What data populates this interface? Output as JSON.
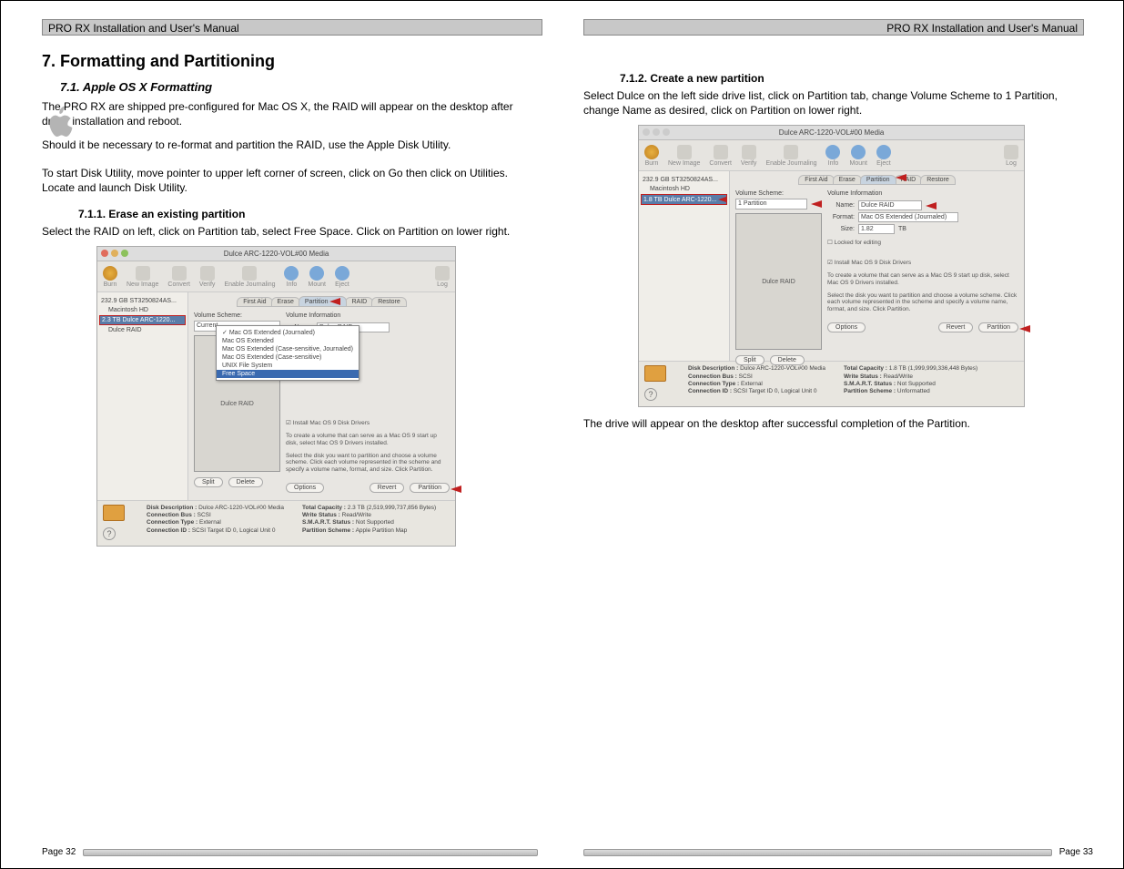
{
  "header": "PRO RX Installation and User's Manual",
  "left": {
    "h1": "7. Formatting and Partitioning",
    "h2": "7.1.        Apple OS X Formatting",
    "p1": "The PRO RX are shipped pre-configured for Mac OS X, the RAID will appear on the desktop after driver installation and reboot.",
    "p2": "Should it be necessary to re-format and partition the RAID, use the Apple Disk Utility.",
    "p3": "To start Disk Utility, move pointer to upper left corner of screen, click on Go then click on Utilities.  Locate and launch Disk Utility.",
    "h3": "7.1.1. Erase an existing partition",
    "p4": "Select the RAID on left, click on Partition tab, select Free Space.  Click on Partition on lower right.",
    "pagenum": "Page 32"
  },
  "right": {
    "h3": "7.1.2. Create a new partition",
    "p1": "Select Dulce on the left side drive list, click on Partition tab, change Volume Scheme to 1 Partition, change Name as desired, click on Partition on lower right.",
    "p2": "The drive will appear on the desktop after successful completion of the Partition.",
    "pagenum": "Page 33"
  },
  "screenshot_common": {
    "toolbar": [
      "Burn",
      "New Image",
      "Convert",
      "Verify",
      "Enable Journaling",
      "Info",
      "Mount",
      "Eject"
    ],
    "log": "Log",
    "tabs": [
      "First Aid",
      "Erase",
      "Partition",
      "RAID",
      "Restore"
    ],
    "vol_scheme_label": "Volume Scheme:",
    "vol_info_label": "Volume Information",
    "name_label": "Name:",
    "format_label": "Format:",
    "size_label": "Size:",
    "install_drivers": "Install Mac OS 9 Disk Drivers",
    "help1": "To create a volume that can serve as a Mac OS 9 start up disk, select Mac OS 9 Drivers installed.",
    "help2": "Select the disk you want to partition and choose a volume scheme. Click each volume represented in the scheme and specify a volume name, format, and size. Click Partition.",
    "buttons": {
      "split": "Split",
      "delete": "Delete",
      "options": "Options",
      "revert": "Revert",
      "partition": "Partition"
    },
    "footer_keys": {
      "desc": "Disk Description :",
      "bus": "Connection Bus :",
      "type": "Connection Type :",
      "id": "Connection ID :",
      "cap": "Total Capacity :",
      "ws": "Write Status :",
      "smart": "S.M.A.R.T. Status :",
      "ps": "Partition Scheme :"
    }
  },
  "ss1": {
    "title": "Dulce ARC-1220-VOL#00 Media",
    "sidebar": [
      "232.9 GB ST3250824AS...",
      "Macintosh HD",
      "2.3 TB Dulce ARC-1220...",
      "Dulce RAID"
    ],
    "selected_index": 2,
    "vol_scheme_value": "Current",
    "vol_box_label": "Dulce RAID",
    "name_value": "Dulce RAID",
    "format_options": [
      "Mac OS Extended (Journaled)",
      "Mac OS Extended",
      "Mac OS Extended (Case-sensitive, Journaled)",
      "Mac OS Extended (Case-sensitive)",
      "UNIX File System",
      "Free Space"
    ],
    "format_checked_index": 0,
    "format_selected_index": 5,
    "footer": {
      "desc": "Dulce ARC-1220-VOL#00 Media",
      "bus": "SCSI",
      "type": "External",
      "id": "SCSI Target ID 0, Logical Unit 0",
      "cap": "2.3 TB (2,519,999,737,856 Bytes)",
      "ws": "Read/Write",
      "smart": "Not Supported",
      "ps": "Apple Partition Map"
    }
  },
  "ss2": {
    "title": "Dulce ARC-1220-VOL#00 Media",
    "sidebar": [
      "232.9 GB ST3250824AS...",
      "Macintosh HD",
      "1.8 TB Dulce ARC-1220..."
    ],
    "selected_index": 2,
    "vol_scheme_value": "1 Partition",
    "vol_box_label": "Dulce RAID",
    "name_value": "Dulce RAID",
    "format_value": "Mac OS Extended (Journaled)",
    "size_value": "1.82",
    "size_unit": "TB",
    "locked": "Locked for editing",
    "footer": {
      "desc": "Dulce ARC-1220-VOL#00 Media",
      "bus": "SCSI",
      "type": "External",
      "id": "SCSI Target ID 0, Logical Unit 0",
      "cap": "1.8 TB (1,999,999,336,448 Bytes)",
      "ws": "Read/Write",
      "smart": "Not Supported",
      "ps": "Unformatted"
    }
  }
}
